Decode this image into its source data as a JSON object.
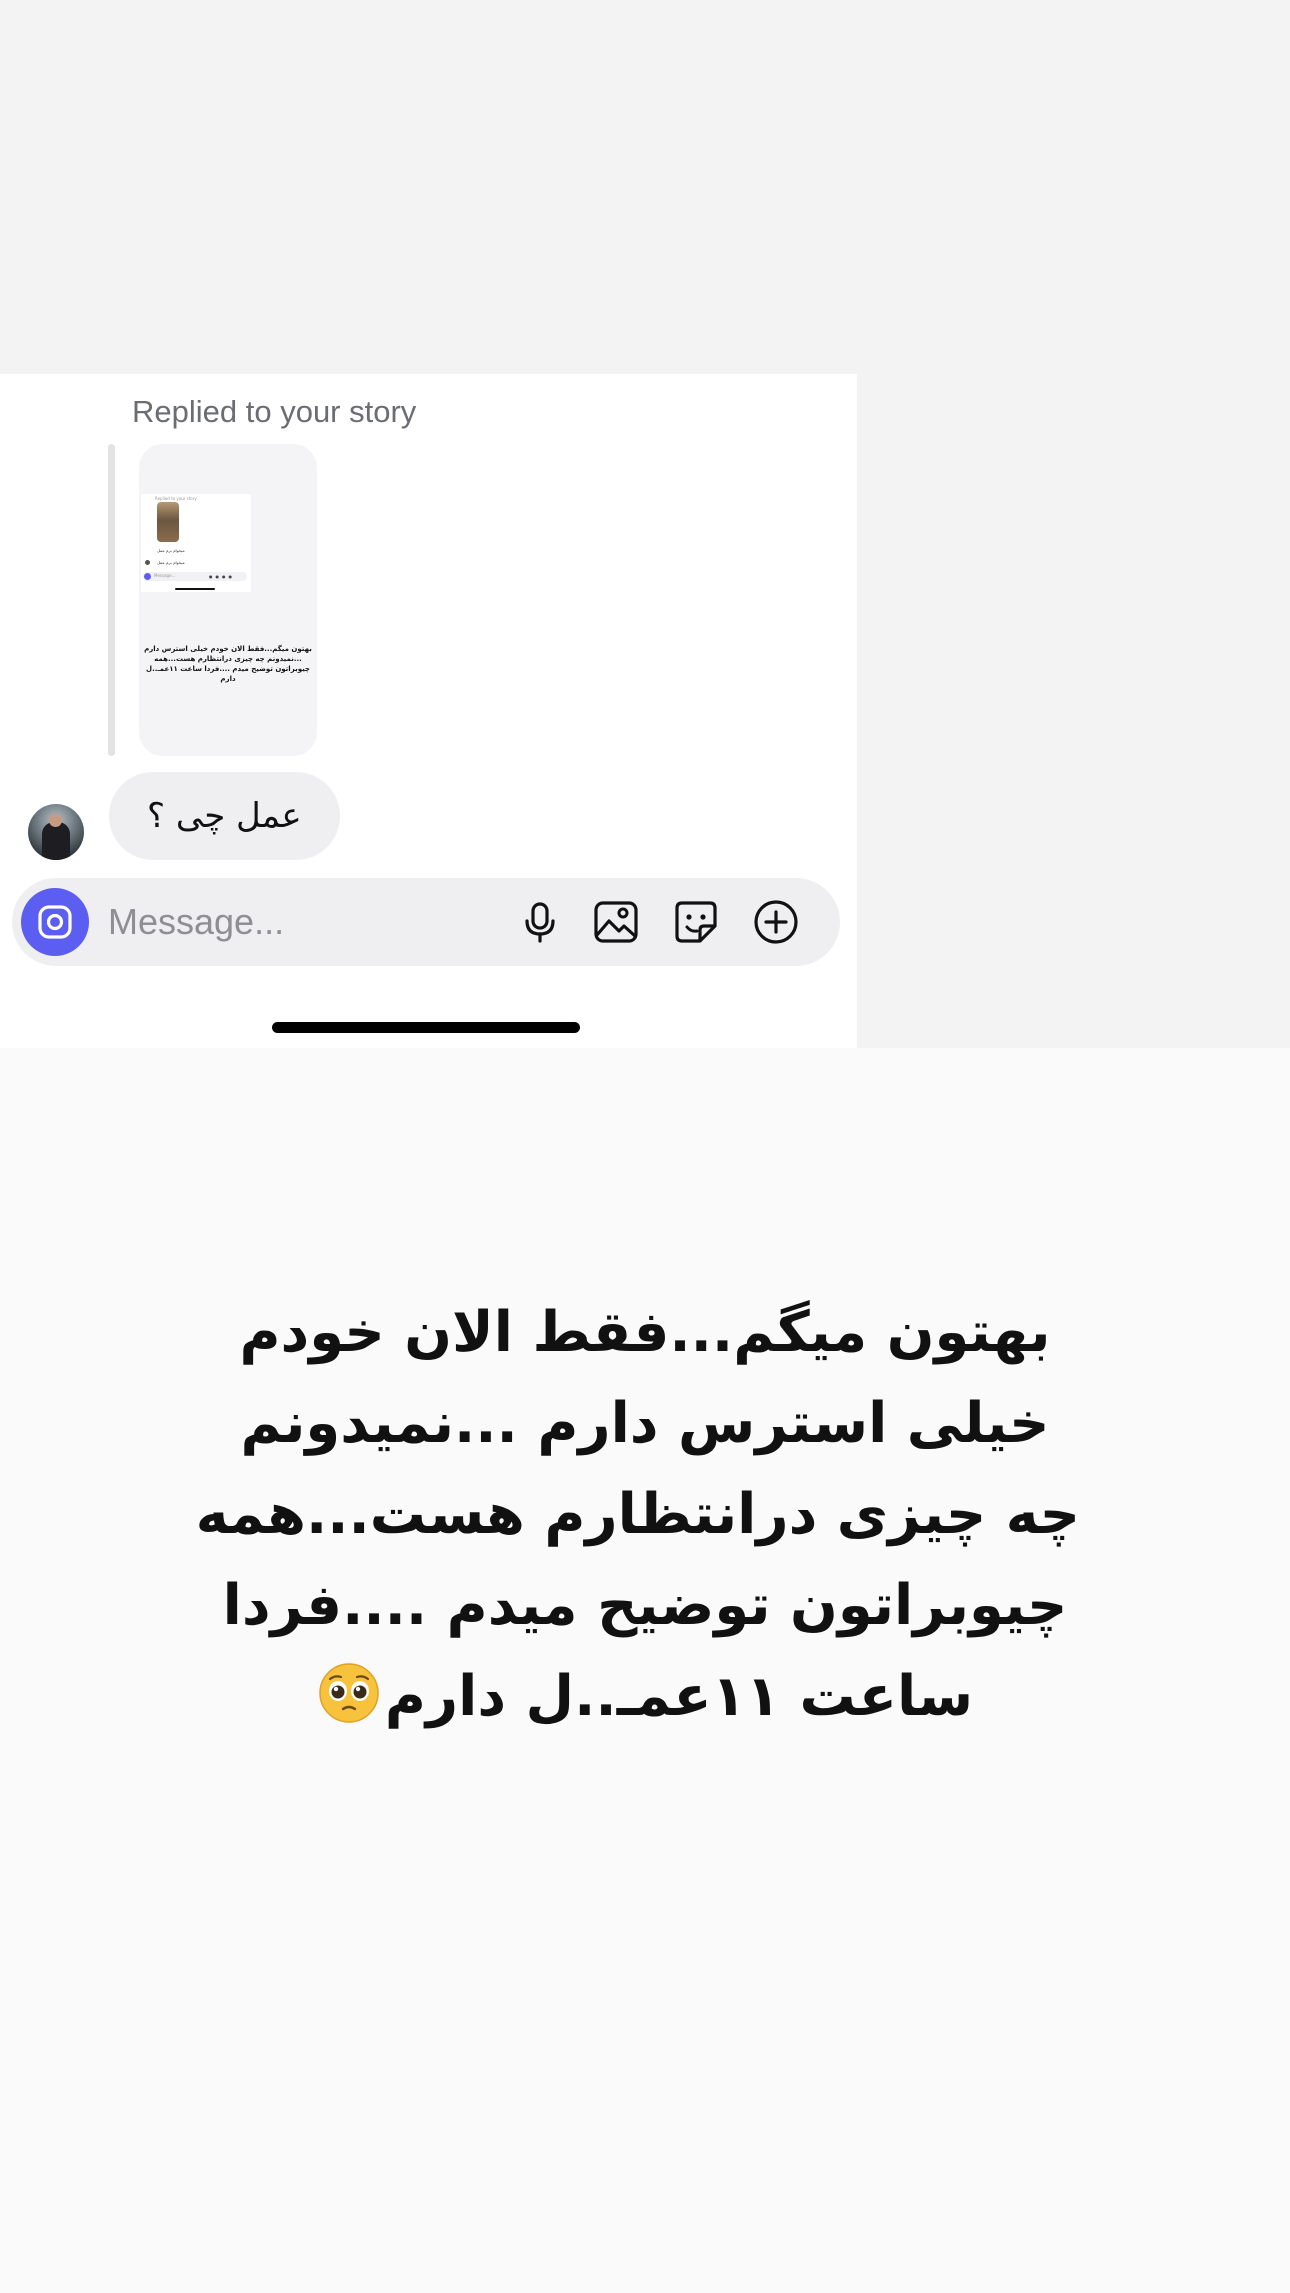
{
  "chat": {
    "replied_label": "Replied to your story",
    "story_thumbnail": {
      "mini_header": "Replied to your story",
      "mini_lines": [
        "میخوام برم عمل",
        "میخوام برم عمل"
      ],
      "mini_input_placeholder": "Message...",
      "caption": "بهتون میگم...فقط الان خودم خیلی استرس دارم ...نمیدونم چه چیزی درانتظارم هست...همه چیوبراتون توضیح میدم ....فردا ساعت ۱۱عمـ..ل دارم"
    },
    "message": {
      "text": "عمل چی ؟"
    },
    "composer": {
      "placeholder": "Message..."
    },
    "colors": {
      "camera_button": "#5b5ef0",
      "bubble": "#efeff1"
    }
  },
  "story": {
    "lines": [
      "بهتون میگم...فقط الان خودم",
      "خیلی استرس دارم ...نمیدونم",
      "چه چیزی درانتظارم هست...همه",
      "چیوبراتون توضیح میدم ....فردا",
      "ساعت ۱۱عمـ..ل دارم"
    ],
    "emoji": "pleading-face"
  }
}
